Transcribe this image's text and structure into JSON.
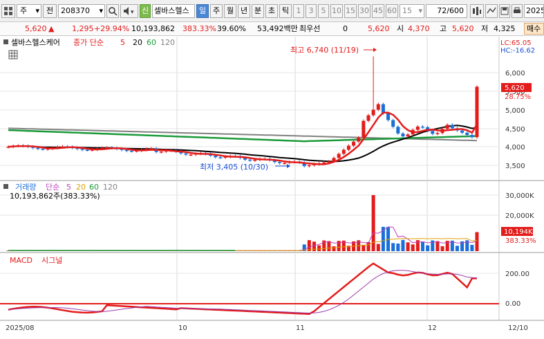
{
  "toolbar": {
    "type_select": "주",
    "prev_label": "전",
    "code": "208370",
    "ui_label": "신",
    "name": "셀바스헬스",
    "periods": [
      "일",
      "주",
      "월",
      "년"
    ],
    "active_period": "일",
    "intraday": [
      "분",
      "초",
      "틱"
    ],
    "numbers": [
      "1",
      "3",
      "5",
      "10",
      "15",
      "30",
      "45",
      "60"
    ],
    "interval_value": "15",
    "count_value": "72",
    "count_total": "/600",
    "date_value": "2025."
  },
  "info": {
    "price": "5,620",
    "arrow": "▲",
    "change": "1,295",
    "change_pct": "+29.94%",
    "volume": "10,193,862",
    "volume_ratio": "383.33%",
    "turnover_ratio": "39.60%",
    "amount": "53,492백만",
    "preferred_label": "최우선",
    "preferred_value": "0",
    "price2": "5,620",
    "open_label": "시",
    "open": "4,370",
    "high_label": "고",
    "high": "5,620",
    "low_label": "저",
    "low": "4,325",
    "buy_label": "매수"
  },
  "price_panel": {
    "stock_label": "셀바스헬스케어",
    "ma_label": "종가 단순",
    "ma_periods": [
      "5",
      "20",
      "60",
      "120"
    ],
    "lc_label": "LC:65.05",
    "hc_label": "HC:-16.62",
    "high_annotation": "최고 6,740 (11/19)",
    "low_annotation": "최저 3,405 (10/30)",
    "current_price_label": "5,620",
    "current_pct_label": "28.75%",
    "y_ticks": [
      "6,000",
      "5,500",
      "5,000",
      "4,500",
      "4,000",
      "3,500"
    ]
  },
  "volume_panel": {
    "title": "거래량",
    "ma_label": "단순",
    "ma_periods": [
      "5",
      "20",
      "60",
      "120"
    ],
    "current_text": "10,193,862주(383.33%)",
    "y_ticks": [
      "30,000K",
      "20,000K"
    ],
    "current_label": "10,194K",
    "current_pct_label": "383.33%"
  },
  "macd_panel": {
    "title": "MACD",
    "signal_label": "시그널",
    "y_ticks": [
      "200.00",
      "0.00"
    ]
  },
  "x_axis": {
    "labels": [
      "2025/08",
      "10",
      "11",
      "12",
      "12/10"
    ]
  },
  "colors": {
    "up": "#e31b1b",
    "down": "#1b6fd8",
    "ma5": "#e31b1b",
    "ma20": "#000000",
    "ma60": "#1a9a3a",
    "ma120": "#808080"
  }
}
